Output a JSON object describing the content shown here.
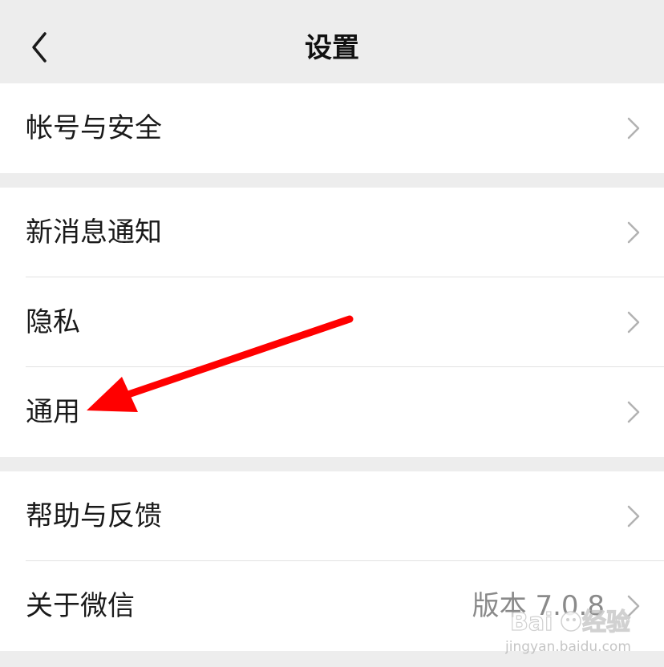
{
  "nav": {
    "title": "设置",
    "back_icon": "chevron-left-icon"
  },
  "groups": [
    {
      "items": [
        {
          "label": "帐号与安全",
          "value": ""
        }
      ]
    },
    {
      "items": [
        {
          "label": "新消息通知",
          "value": ""
        },
        {
          "label": "隐私",
          "value": ""
        },
        {
          "label": "通用",
          "value": ""
        }
      ]
    },
    {
      "items": [
        {
          "label": "帮助与反馈",
          "value": ""
        },
        {
          "label": "关于微信",
          "value": "版本 7.0.8"
        }
      ]
    }
  ],
  "annotation": {
    "arrow_color": "#ff0000",
    "target": "通用"
  },
  "watermark": {
    "brand": "Baidu经验",
    "url": "jingyan.baidu.com"
  },
  "colors": {
    "background": "#ededed",
    "card": "#ffffff",
    "chevron": "#b2b2b2",
    "secondary_text": "#8a8a8a"
  }
}
